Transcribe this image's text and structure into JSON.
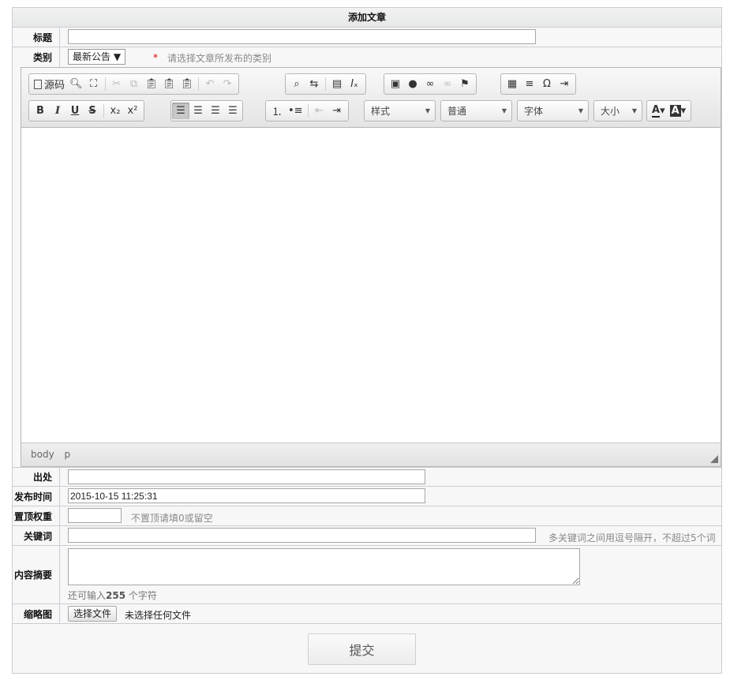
{
  "form": {
    "title": "添加文章",
    "labels": {
      "title": "标题",
      "category": "类别",
      "source": "出处",
      "publish_time": "发布时间",
      "top_weight": "置顶权重",
      "keywords": "关键词",
      "summary": "内容摘要",
      "thumbnail": "缩略图"
    },
    "category_value": "最新公告 ▼",
    "category_required": "*",
    "category_hint": "请选择文章所发布的类别",
    "publish_time_value": "2015-10-15 11:25:31",
    "top_weight_hint": "不置顶请填0或留空",
    "keywords_hint": "多关键词之间用逗号隔开，不超过5个词",
    "summary_remaining_prefix": "还可输入",
    "summary_remaining_count": "255",
    "summary_remaining_suffix": "个字符",
    "file_button": "选择文件",
    "file_status": "未选择任何文件",
    "submit": "提交"
  },
  "editor": {
    "source_label": "源码",
    "combos": {
      "style": "样式",
      "format": "普通",
      "font": "字体",
      "size": "大小"
    },
    "path": [
      "body",
      "p"
    ]
  }
}
